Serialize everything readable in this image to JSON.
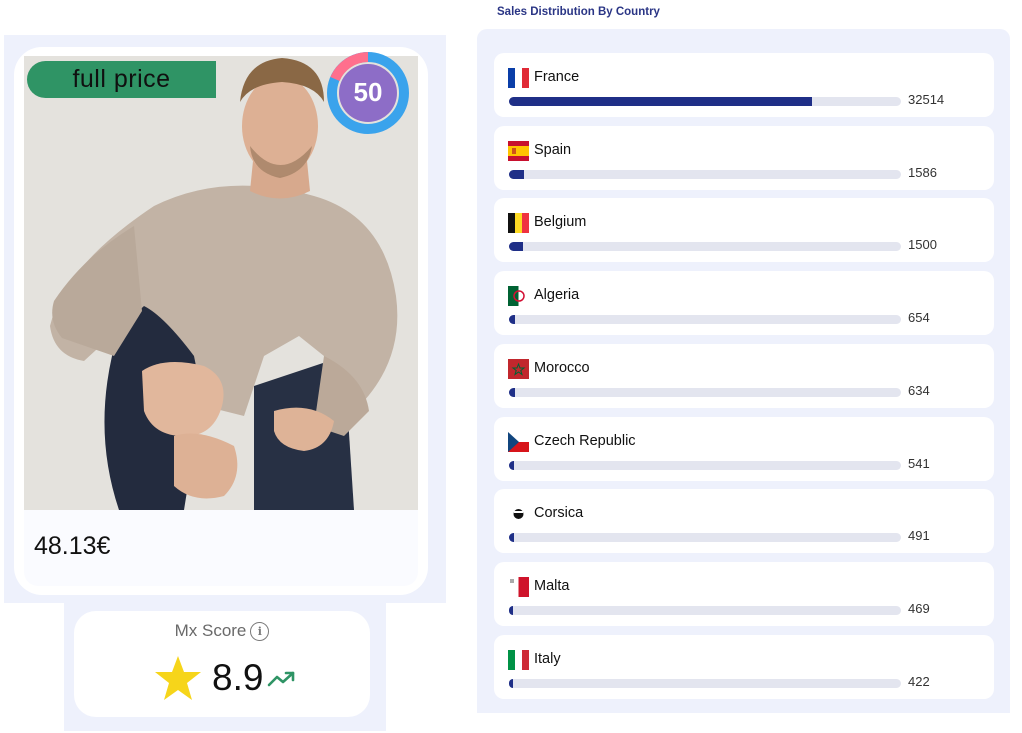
{
  "product": {
    "badge_label": "full price",
    "score": "50",
    "price": "48.13€",
    "photo_icon": "product-photo-man-sweater"
  },
  "mx_score": {
    "label": "Mx Score",
    "value": "8.9",
    "star_icon": "star-icon",
    "trend_icon": "trending-up-icon"
  },
  "sales": {
    "title": "Sales Distribution By Country",
    "max": 42000,
    "countries": [
      {
        "name": "France",
        "value": 32514
      },
      {
        "name": "Spain",
        "value": 1586
      },
      {
        "name": "Belgium",
        "value": 1500
      },
      {
        "name": "Algeria",
        "value": 654
      },
      {
        "name": "Morocco",
        "value": 634
      },
      {
        "name": "Czech Republic",
        "value": 541
      },
      {
        "name": "Corsica",
        "value": 491
      },
      {
        "name": "Malta",
        "value": 469
      },
      {
        "name": "Italy",
        "value": 422
      }
    ]
  },
  "colors": {
    "bar": "#1f2f87",
    "badge": "#2f9465",
    "donut_outer": "#3aa3ec",
    "donut_pink": "#ff6f8d",
    "donut_inner": "#8d6dc7"
  }
}
